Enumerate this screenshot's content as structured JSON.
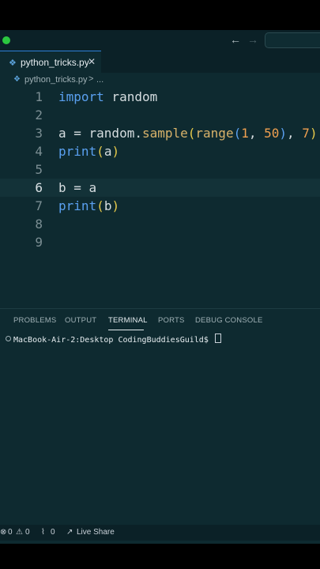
{
  "window": {
    "traffic_light_color": "#2bc840"
  },
  "editor_tab": {
    "filename": "python_tricks.py",
    "close_glyph": "✕"
  },
  "breadcrumb": {
    "file": "python_tricks.py",
    "separator": ">",
    "more": "..."
  },
  "code_lines": [
    {
      "n": "1",
      "text": "import random"
    },
    {
      "n": "2",
      "text": ""
    },
    {
      "n": "3",
      "text": "a = random.sample(range(1, 50), 7)"
    },
    {
      "n": "4",
      "text": "print(a)"
    },
    {
      "n": "5",
      "text": ""
    },
    {
      "n": "6",
      "text": "b = a"
    },
    {
      "n": "7",
      "text": "print(b)"
    },
    {
      "n": "8",
      "text": ""
    },
    {
      "n": "9",
      "text": ""
    }
  ],
  "panel": {
    "tabs": [
      "PROBLEMS",
      "OUTPUT",
      "TERMINAL",
      "PORTS",
      "DEBUG CONSOLE"
    ],
    "active_tab": "TERMINAL",
    "terminal_prompt": "MacBook-Air-2:Desktop CodingBuddiesGuild$"
  },
  "status_bar": {
    "errors": "0",
    "warnings": "0",
    "ports": "0",
    "live_share": "Live Share"
  },
  "colors": {
    "keyword": "#5aa0f0",
    "function": "#d8b26a",
    "number": "#f0a050",
    "bracket": "#e6c94a",
    "background": "#0e2a30"
  }
}
